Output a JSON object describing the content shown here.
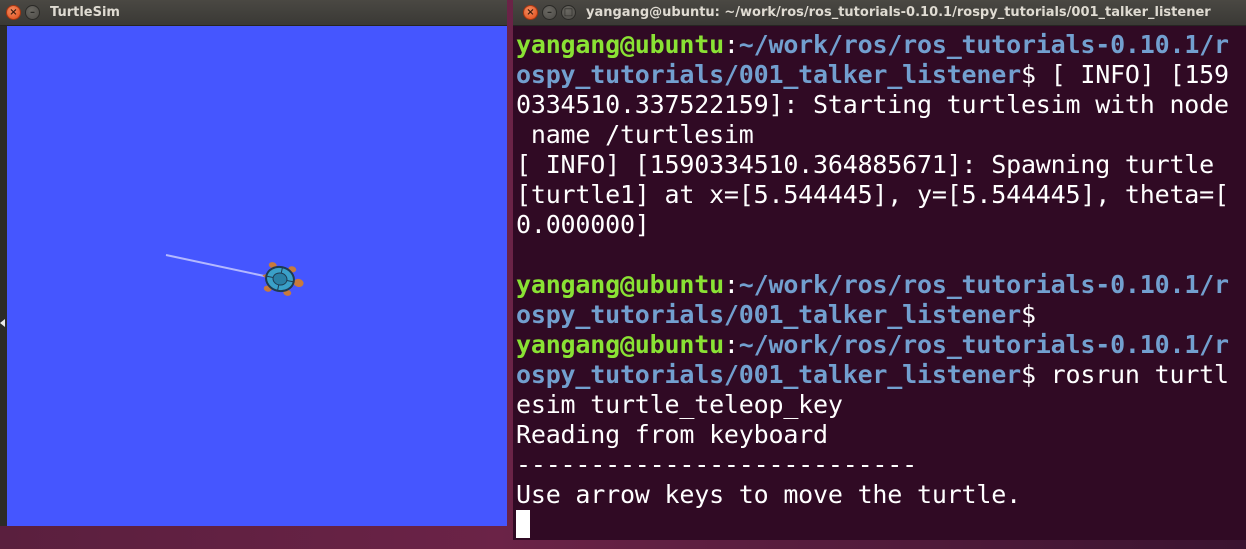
{
  "turtlesim": {
    "title": "TurtleSim",
    "canvas_color": "#4556ff",
    "turtle_color": "#3aa0c8",
    "trail_color": "#b3b8ff"
  },
  "terminal": {
    "title": "yangang@ubuntu: ~/work/ros/ros_tutorials-0.10.1/rospy_tutorials/001_talker_listener",
    "colors": {
      "user": "#8ae234",
      "path": "#729fcf",
      "text": "#ffffff",
      "background": "#300a24"
    },
    "lines": [
      {
        "user": "yangang@ubuntu",
        "sep": ":",
        "path": "~/work/ros/ros_tutorials-0.10.1/r",
        "text": ""
      },
      {
        "user": "",
        "sep": "",
        "path": "ospy_tutorials/001_talker_listener",
        "text": "$ [ INFO] [159"
      },
      {
        "user": "",
        "sep": "",
        "path": "",
        "text": "0334510.337522159]: Starting turtlesim with node"
      },
      {
        "user": "",
        "sep": "",
        "path": "",
        "text": " name /turtlesim"
      },
      {
        "user": "",
        "sep": "",
        "path": "",
        "text": "[ INFO] [1590334510.364885671]: Spawning turtle"
      },
      {
        "user": "",
        "sep": "",
        "path": "",
        "text": "[turtle1] at x=[5.544445], y=[5.544445], theta=["
      },
      {
        "user": "",
        "sep": "",
        "path": "",
        "text": "0.000000]"
      },
      {
        "user": "",
        "sep": "",
        "path": "",
        "text": ""
      },
      {
        "user": "yangang@ubuntu",
        "sep": ":",
        "path": "~/work/ros/ros_tutorials-0.10.1/r",
        "text": ""
      },
      {
        "user": "",
        "sep": "",
        "path": "ospy_tutorials/001_talker_listener",
        "text": "$"
      },
      {
        "user": "yangang@ubuntu",
        "sep": ":",
        "path": "~/work/ros/ros_tutorials-0.10.1/r",
        "text": ""
      },
      {
        "user": "",
        "sep": "",
        "path": "ospy_tutorials/001_talker_listener",
        "text": "$ rosrun turtl"
      },
      {
        "user": "",
        "sep": "",
        "path": "",
        "text": "esim turtle_teleop_key"
      },
      {
        "user": "",
        "sep": "",
        "path": "",
        "text": "Reading from keyboard"
      },
      {
        "user": "",
        "sep": "",
        "path": "",
        "text": "---------------------------"
      },
      {
        "user": "",
        "sep": "",
        "path": "",
        "text": "Use arrow keys to move the turtle."
      }
    ]
  }
}
